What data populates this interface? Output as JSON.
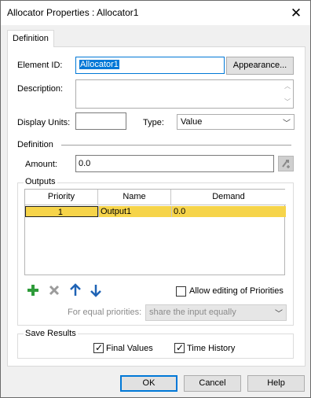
{
  "window": {
    "title": "Allocator Properties : Allocator1",
    "close_glyph": "✕"
  },
  "tab": {
    "label": "Definition"
  },
  "form": {
    "element_id_label": "Element ID:",
    "element_id_value": "Allocator1",
    "appearance_button": "Appearance...",
    "description_label": "Description:",
    "description_value": "",
    "display_units_label": "Display Units:",
    "display_units_value": "",
    "type_label": "Type:",
    "type_value": "Value",
    "definition_header": "Definition",
    "amount_label": "Amount:",
    "amount_value": "0.0"
  },
  "outputs": {
    "header": "Outputs",
    "columns": [
      "Priority",
      "Name",
      "Demand"
    ],
    "rows": [
      {
        "priority": "1",
        "name": "Output1",
        "demand": "0.0"
      }
    ],
    "allow_editing_label": "Allow editing of Priorities",
    "allow_editing_checked": false,
    "equal_priorities_label": "For equal priorities:",
    "equal_priorities_value": "share the input equally"
  },
  "save_results": {
    "header": "Save Results",
    "final_values_label": "Final Values",
    "final_values_checked": true,
    "time_history_label": "Time History",
    "time_history_checked": true
  },
  "buttons": {
    "ok": "OK",
    "cancel": "Cancel",
    "help": "Help"
  },
  "colors": {
    "accent": "#0078d7",
    "selected_row": "#f6d44a",
    "add_icon": "#2e9b3a",
    "arrow_icon": "#1f63b5"
  },
  "icons": {
    "add": "plus-icon",
    "delete": "x-icon",
    "move_up": "arrow-up-icon",
    "move_down": "arrow-down-icon",
    "link": "link-icon"
  }
}
